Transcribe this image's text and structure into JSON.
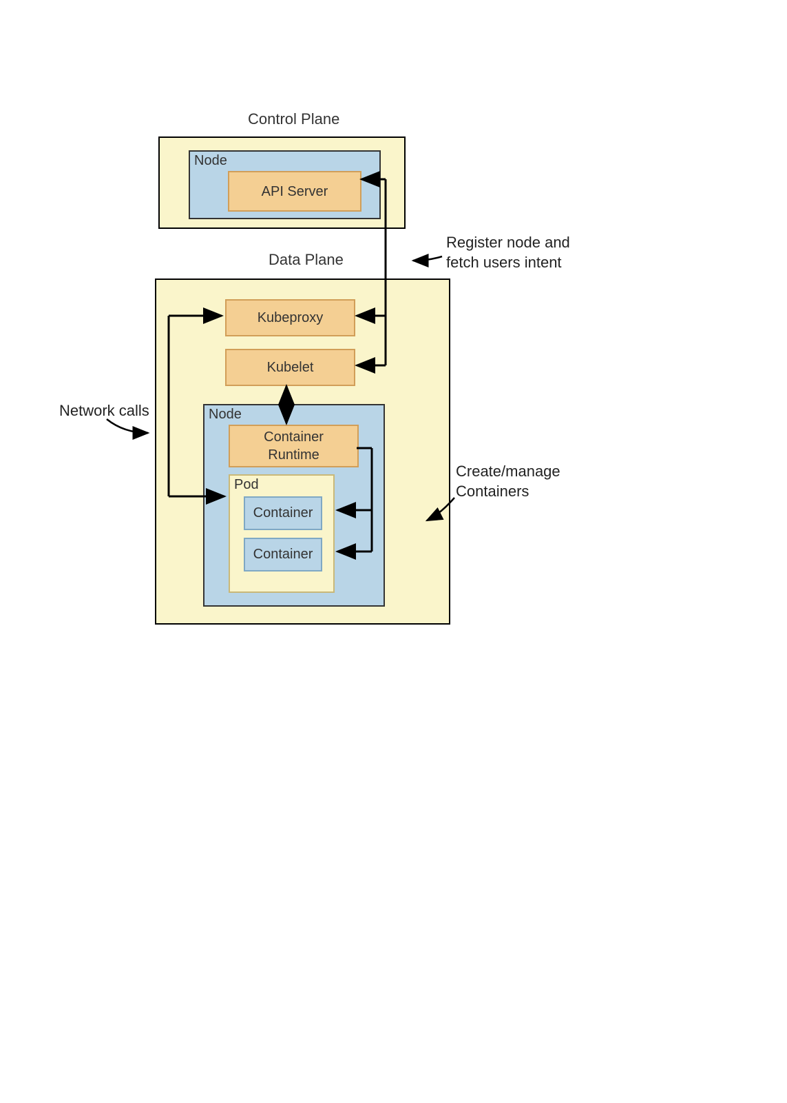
{
  "titles": {
    "control_plane": "Control Plane",
    "data_plane": "Data Plane"
  },
  "control_plane": {
    "node_label": "Node",
    "api_server": "API Server"
  },
  "data_plane": {
    "kubeproxy": "Kubeproxy",
    "kubelet": "Kubelet",
    "node_label": "Node",
    "container_runtime": "Container\nRuntime",
    "pod_label": "Pod",
    "container1": "Container",
    "container2": "Container"
  },
  "annotations": {
    "register": "Register node and\nfetch users intent",
    "network_calls": "Network calls",
    "create_manage": "Create/manage\nContainers"
  }
}
